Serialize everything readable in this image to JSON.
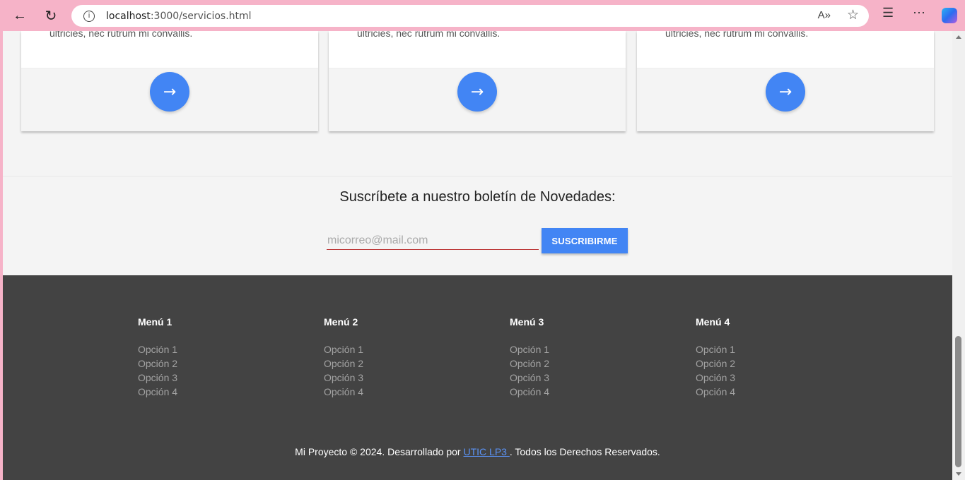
{
  "browser": {
    "url_host": "localhost",
    "url_path": ":3000/servicios.html"
  },
  "cards": [
    {
      "text": "ultricies, nec rutrum mi convallis.",
      "button_icon": "→"
    },
    {
      "text": "ultricies, nec rutrum mi convallis.",
      "button_icon": "→"
    },
    {
      "text": "ultricies, nec rutrum mi convallis.",
      "button_icon": "→"
    }
  ],
  "newsletter": {
    "title": "Suscríbete a nuestro boletín de Novedades:",
    "email_placeholder": "micorreo@mail.com",
    "button_label": "SUSCRIBIRME"
  },
  "footer": {
    "menus": [
      {
        "title": "Menú 1",
        "options": [
          "Opción 1",
          "Opción 2",
          "Opción 3",
          "Opción 4"
        ]
      },
      {
        "title": "Menú 2",
        "options": [
          "Opción 1",
          "Opción 2",
          "Opción 3",
          "Opción 4"
        ]
      },
      {
        "title": "Menú 3",
        "options": [
          "Opción 1",
          "Opción 2",
          "Opción 3",
          "Opción 4"
        ]
      },
      {
        "title": "Menú 4",
        "options": [
          "Opción 1",
          "Opción 2",
          "Opción 3",
          "Opción 4"
        ]
      }
    ],
    "copyright_prefix": "Mi Proyecto © 2024. Desarrollado por ",
    "copyright_link": "UTIC LP3 ",
    "copyright_suffix": ". Todos los Derechos Reservados."
  },
  "colors": {
    "accent": "#4285f4",
    "footer_bg": "#434343",
    "chrome_bg": "#f6b3c8"
  }
}
